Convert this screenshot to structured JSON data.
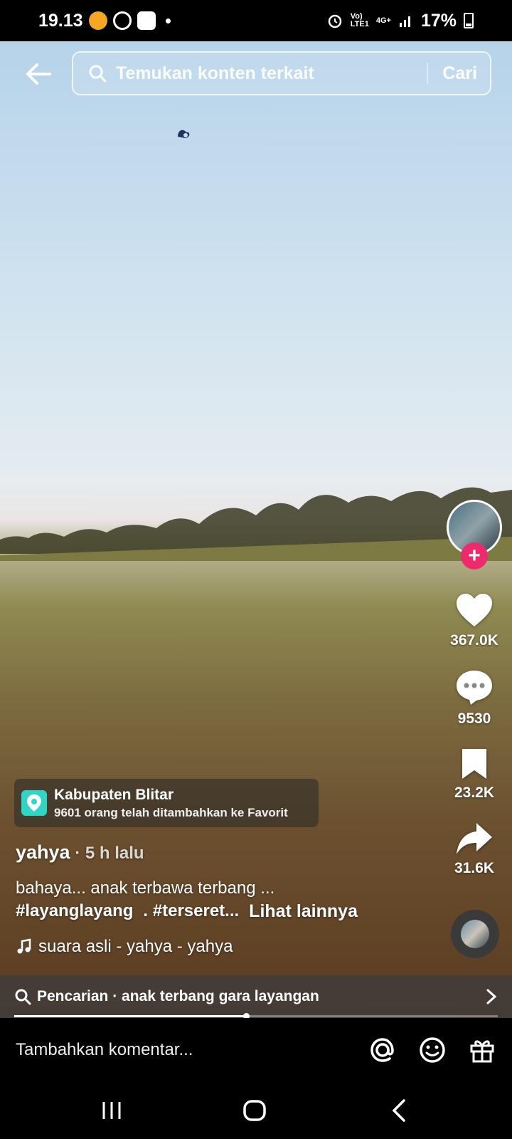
{
  "status_bar": {
    "time": "19.13",
    "network_small_top": "Vo)",
    "network_small_bottom": "LTE1",
    "network_type": "4G+",
    "battery": "17%"
  },
  "search": {
    "placeholder": "Temukan konten terkait",
    "button": "Cari"
  },
  "actions": {
    "likes": "367.0K",
    "comments": "9530",
    "saves": "23.2K",
    "shares": "31.6K"
  },
  "location": {
    "name": "Kabupaten Blitar",
    "subtitle": "9601 orang telah ditambahkan ke Favorit"
  },
  "post": {
    "author": "yahya",
    "time": " · 5 h lalu",
    "caption_line1": "bahaya... anak terbawa terbang ...",
    "hashtag1": "#layanglayang",
    "hashtag2": ". #terseret...",
    "see_more": "Lihat lainnya",
    "music": "suara asli - yahya - yahya"
  },
  "suggested_search": {
    "text": "Pencarian · anak terbang gara layangan",
    "progress": 0.48
  },
  "comment": {
    "placeholder": "Tambahkan komentar..."
  },
  "icons": [
    "back-arrow-icon",
    "search-icon",
    "heart-icon",
    "comment-icon",
    "bookmark-icon",
    "share-icon",
    "music-note-icon",
    "mention-icon",
    "emoji-icon",
    "gift-icon",
    "chevron-right-icon",
    "location-pin-icon",
    "recents-icon",
    "home-icon",
    "nav-back-icon"
  ],
  "colors": {
    "follow_button": "#ee2a6c",
    "location_pin": "#2fd5c5"
  }
}
